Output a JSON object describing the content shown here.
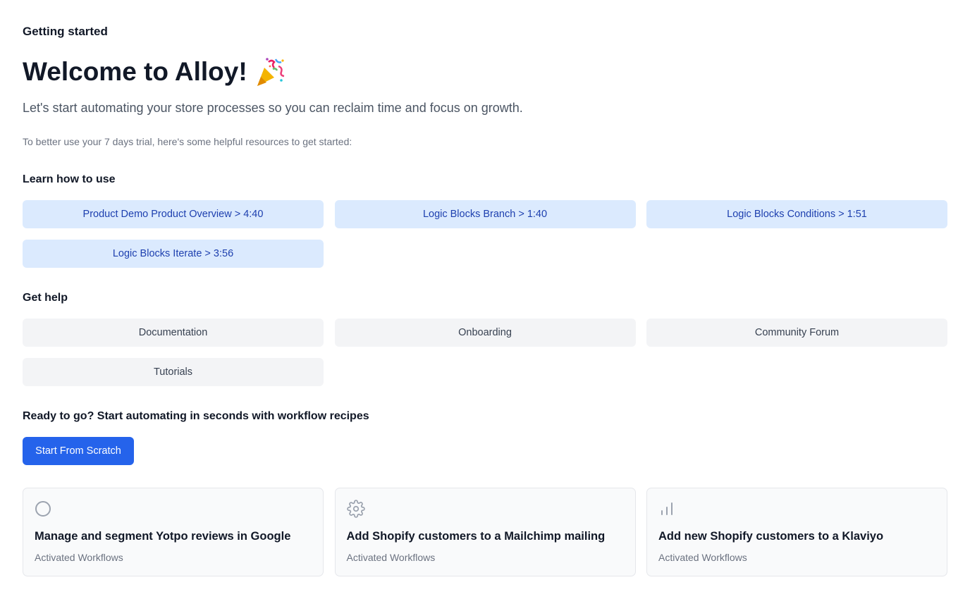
{
  "header": {
    "section_title": "Getting started",
    "welcome_title": "Welcome to Alloy!",
    "welcome_icon": "party-popper-icon",
    "subtitle": "Let's start automating your store processes so you can reclaim time and focus on growth.",
    "trial_note": "To better use your 7 days trial, here's some helpful resources to get started:"
  },
  "learn": {
    "title": "Learn how to use",
    "items": [
      {
        "label": "Product Demo Product Overview > 4:40"
      },
      {
        "label": "Logic Blocks Branch > 1:40"
      },
      {
        "label": "Logic Blocks Conditions > 1:51"
      },
      {
        "label": "Logic Blocks Iterate > 3:56"
      }
    ]
  },
  "help": {
    "title": "Get help",
    "items": [
      {
        "label": "Documentation"
      },
      {
        "label": "Onboarding"
      },
      {
        "label": "Community Forum"
      },
      {
        "label": "Tutorials"
      }
    ]
  },
  "recipes": {
    "title": "Ready to go? Start automating in seconds with workflow recipes",
    "start_button": "Start From Scratch",
    "cards": [
      {
        "icon": "circle-icon",
        "title": "Manage and segment Yotpo reviews in Google",
        "subtitle": "Activated Workflows"
      },
      {
        "icon": "gear-icon",
        "title": "Add Shopify customers to a Mailchimp mailing",
        "subtitle": "Activated Workflows"
      },
      {
        "icon": "bar-chart-icon",
        "title": "Add new Shopify customers to a Klaviyo",
        "subtitle": "Activated Workflows"
      }
    ]
  },
  "colors": {
    "primary": "#2563eb",
    "learn_bg": "#dbeafe",
    "learn_text": "#1e40af",
    "help_bg": "#f3f4f6"
  }
}
